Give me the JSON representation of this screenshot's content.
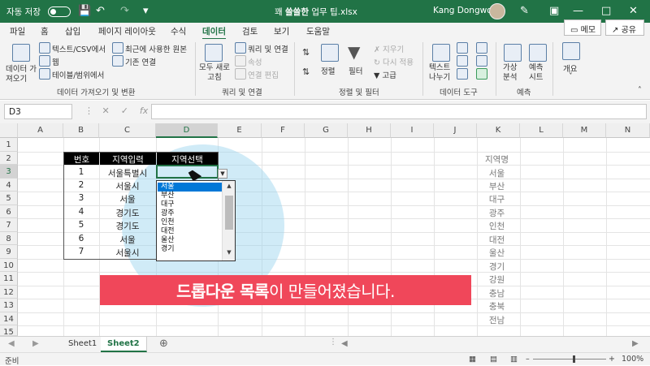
{
  "titlebar": {
    "autosave_label": "자동 저장",
    "autosave_state": "끔",
    "filename_prefix": "꽤 ",
    "filename_bold": "쓸쓸한",
    "filename_suffix": " 업무 팁.xlsx",
    "user": "Kang Dongwoo"
  },
  "menu": {
    "items": [
      "파일",
      "홈",
      "삽입",
      "페이지 레이아웃",
      "수식",
      "데이터",
      "검토",
      "보기",
      "도움말"
    ],
    "active": "데이터",
    "memo_label": "메모",
    "share_label": "공유"
  },
  "ribbon": {
    "get_data": "데이터 가\n져오기",
    "from_text_csv": "텍스트/CSV에서",
    "from_web": "웹",
    "from_table": "테이블/범위에서",
    "recent_sources": "최근에 사용한 원본",
    "existing_connections": "기존 연결",
    "refresh_all": "모두 새로\n고침",
    "queries_connections": "쿼리 및 연결",
    "properties": "속성",
    "edit_links": "연결 편집",
    "sort": "정렬",
    "filter": "필터",
    "clear": "지우기",
    "reapply": "다시 적용",
    "advanced": "고급",
    "text_to_columns": "텍스트\n나누기",
    "what_if": "가상\n분석",
    "forecast_sheet": "예측\n시트",
    "outline": "개요",
    "groups": {
      "get_transform": "데이터 가져오기 및 변환",
      "queries": "쿼리 및 연결",
      "sort_filter": "정렬 및 필터",
      "data_tools": "데이터 도구",
      "forecast": "예측"
    }
  },
  "formula_bar": {
    "name_box": "D3",
    "formula": ""
  },
  "columns": [
    "A",
    "B",
    "C",
    "D",
    "E",
    "F",
    "G",
    "H",
    "I",
    "J",
    "K",
    "L",
    "M",
    "N"
  ],
  "rows": [
    "1",
    "2",
    "3",
    "4",
    "5",
    "6",
    "7",
    "8",
    "9",
    "10",
    "11",
    "12",
    "13",
    "14",
    "15"
  ],
  "table": {
    "headers": [
      "번호",
      "지역입력",
      "지역선택"
    ],
    "rows": [
      [
        "1",
        "서울특별시"
      ],
      [
        "2",
        "서울시"
      ],
      [
        "3",
        "서울"
      ],
      [
        "4",
        "경기도"
      ],
      [
        "5",
        "경기도"
      ],
      [
        "6",
        "서울"
      ],
      [
        "7",
        "서울시"
      ]
    ]
  },
  "region_list": [
    "지역명",
    "서울",
    "부산",
    "대구",
    "광주",
    "인천",
    "대전",
    "울산",
    "경기",
    "강원",
    "충남",
    "충북",
    "전남"
  ],
  "dropdown": {
    "selected": "서울",
    "options": [
      "서울",
      "부산",
      "대구",
      "광주",
      "인천",
      "대전",
      "울산",
      "경기"
    ]
  },
  "banner": {
    "bold_part": "드롭다운 목록",
    "rest": "이 만들어졌습니다."
  },
  "sheets": {
    "tabs": [
      "Sheet1",
      "Sheet2"
    ],
    "active": "Sheet2"
  },
  "status": {
    "ready": "준비",
    "zoom": "100%"
  }
}
